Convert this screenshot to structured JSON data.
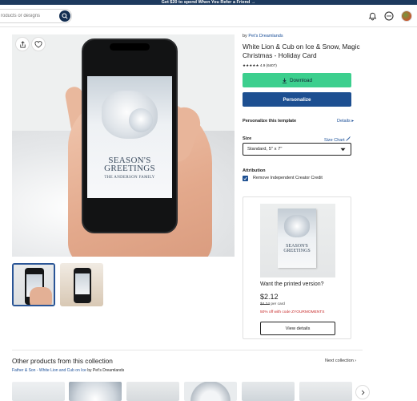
{
  "banner": {
    "text": "Get $20 to spend When You Refer a Friend →"
  },
  "search": {
    "placeholder": "roducts or designs"
  },
  "header_icons": [
    "bell-icon",
    "chat-icon",
    "avatar"
  ],
  "product": {
    "by_prefix": "by",
    "store": "Pet's Dreamlands",
    "title": "White Lion & Cub on Ice & Snow, Magic Christmas - Holiday Card",
    "stars": "★★★★★",
    "rating": "4.9 (6407)",
    "download_label": "Download",
    "personalize_label": "Personalize",
    "personalize_section": "Personalize this template",
    "details_link": "Details ▸",
    "size_label": "Size",
    "size_chart_link": "Size Chart",
    "size_value": "Standard, 5\" x 7\"",
    "attribution_label": "Attribution",
    "attribution_option": "Remove Independent Creator Credit",
    "attribution_checked": true
  },
  "card_art": {
    "greeting_line1": "SEASON'S",
    "greeting_line2": "GREETINGS",
    "family": "THE ANDERSON FAMILY"
  },
  "print_offer": {
    "heading": "Want the printed version?",
    "price": "$2.12",
    "old_price": "$4.24",
    "old_price_suffix": " per card",
    "promo": "50% off with code ZYOURMOMENTS",
    "button": "View details"
  },
  "collection": {
    "title": "Other products from this collection",
    "next_link": "Next collection ›",
    "sub_link": "Father & Son - White Lion and Cub on Ice",
    "sub_by": " by Pet's Dreamlands"
  },
  "colors": {
    "download": "#3ccf8e",
    "personalize": "#1d4f91",
    "link": "#1b4f98",
    "promo": "#c62828"
  }
}
